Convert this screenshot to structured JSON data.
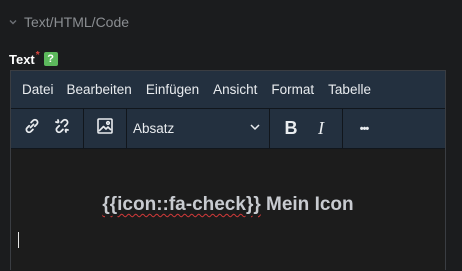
{
  "section": {
    "title": "Text/HTML/Code"
  },
  "field": {
    "label": "Text",
    "required_mark": "*",
    "help_icon": "question-icon",
    "help_glyph": "?"
  },
  "menubar": {
    "items": [
      {
        "label": "Datei"
      },
      {
        "label": "Bearbeiten"
      },
      {
        "label": "Einfügen"
      },
      {
        "label": "Ansicht"
      },
      {
        "label": "Format"
      },
      {
        "label": "Tabelle"
      }
    ]
  },
  "toolbar": {
    "link_icon": "link-icon",
    "unlink_icon": "unlink-icon",
    "image_icon": "image-icon",
    "block_format": "Absatz",
    "bold_label": "B",
    "italic_label": "I",
    "more_label": "•••"
  },
  "content": {
    "shortcode": "{{icon::fa-check}}",
    "text": " Mein Icon"
  },
  "colors": {
    "background": "#1b1c1e",
    "toolbar": "#23303f",
    "help_badge": "#5cb85c",
    "required": "#e0443d"
  }
}
